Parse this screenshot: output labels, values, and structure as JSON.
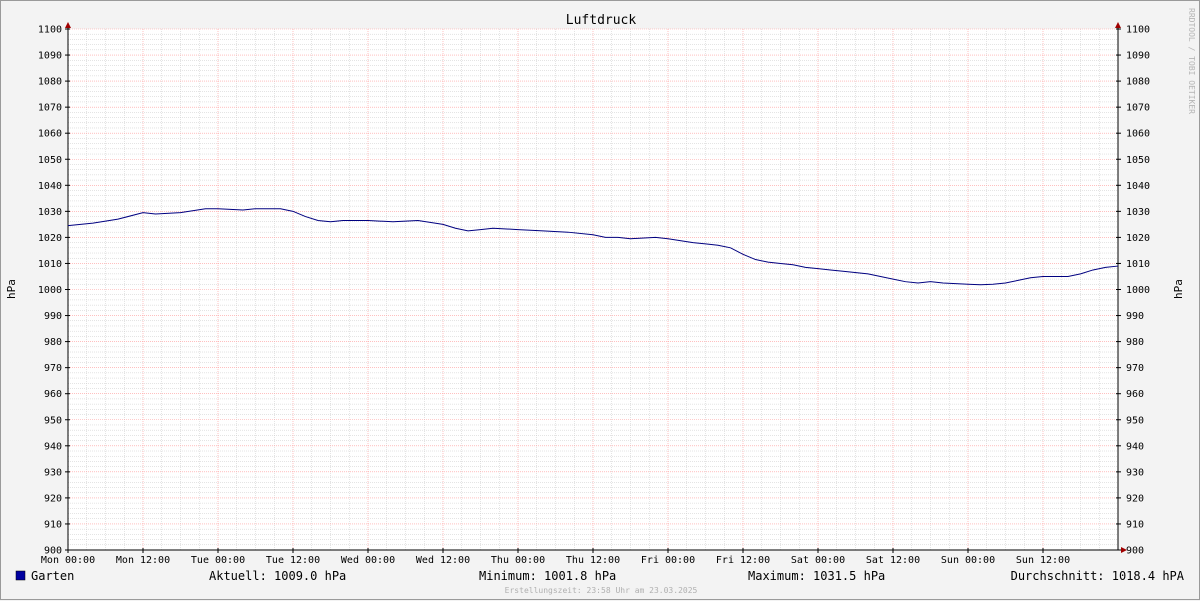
{
  "chart_data": {
    "type": "line",
    "title": "Luftdruck",
    "ylabel": "hPa",
    "ylim": [
      900,
      1100
    ],
    "ytick_step": 10,
    "xlim": [
      0,
      168
    ],
    "x_unit": "hours from Mon 00:00",
    "x_ticks": [
      {
        "x": 0,
        "label": "Mon 00:00"
      },
      {
        "x": 12,
        "label": "Mon 12:00"
      },
      {
        "x": 24,
        "label": "Tue 00:00"
      },
      {
        "x": 36,
        "label": "Tue 12:00"
      },
      {
        "x": 48,
        "label": "Wed 00:00"
      },
      {
        "x": 60,
        "label": "Wed 12:00"
      },
      {
        "x": 72,
        "label": "Thu 00:00"
      },
      {
        "x": 84,
        "label": "Thu 12:00"
      },
      {
        "x": 96,
        "label": "Fri 00:00"
      },
      {
        "x": 108,
        "label": "Fri 12:00"
      },
      {
        "x": 120,
        "label": "Sat 00:00"
      },
      {
        "x": 132,
        "label": "Sat 12:00"
      },
      {
        "x": 144,
        "label": "Sun 00:00"
      },
      {
        "x": 156,
        "label": "Sun 12:00"
      }
    ],
    "grid": true,
    "colors": {
      "series": "#000080",
      "major_grid": "#ff9a9a",
      "minor_grid": "#c9c9c9",
      "axis": "#000000",
      "arrow": "#a00000",
      "legend_box": "#0000a0"
    },
    "series": [
      {
        "name": "Garten",
        "x": [
          0,
          4,
          8,
          12,
          14,
          18,
          22,
          24,
          28,
          30,
          34,
          36,
          38,
          40,
          42,
          44,
          48,
          52,
          56,
          60,
          62,
          64,
          66,
          68,
          72,
          76,
          80,
          84,
          86,
          88,
          90,
          94,
          96,
          100,
          102,
          104,
          106,
          108,
          110,
          112,
          114,
          116,
          118,
          120,
          122,
          124,
          128,
          130,
          132,
          134,
          136,
          138,
          140,
          144,
          146,
          148,
          150,
          152,
          154,
          156,
          160,
          162,
          164,
          166,
          168
        ],
        "y": [
          1024.5,
          1025.5,
          1027,
          1029.5,
          1029,
          1029.5,
          1031,
          1031,
          1030.5,
          1031,
          1031,
          1030,
          1028,
          1026.5,
          1026,
          1026.5,
          1026.5,
          1026,
          1026.5,
          1025,
          1023.5,
          1022.5,
          1023,
          1023.5,
          1023,
          1022.5,
          1022,
          1021,
          1020,
          1020,
          1019.5,
          1020,
          1019.5,
          1018,
          1017.5,
          1017,
          1016,
          1013.5,
          1011.5,
          1010.5,
          1010,
          1009.5,
          1008.5,
          1008,
          1007.5,
          1007,
          1006,
          1005,
          1004,
          1003,
          1002.5,
          1003,
          1002.5,
          1002,
          1001.8,
          1002,
          1002.5,
          1003.5,
          1004.5,
          1005,
          1005,
          1006,
          1007.5,
          1008.5,
          1009
        ]
      }
    ],
    "legend": {
      "label": "Garten",
      "placement": "bottom-left"
    },
    "stats": {
      "current": "Aktuell: 1009.0 hPa",
      "minimum": "Minimum: 1001.8 hPa",
      "maximum": "Maximum: 1031.5 hPa",
      "average": "Durchschnitt: 1018.4 hPA"
    },
    "footer": "Erstellungszeit: 23:58 Uhr am 23.03.2025",
    "watermark": "RRDTOOL / TOBI OETIKER"
  }
}
